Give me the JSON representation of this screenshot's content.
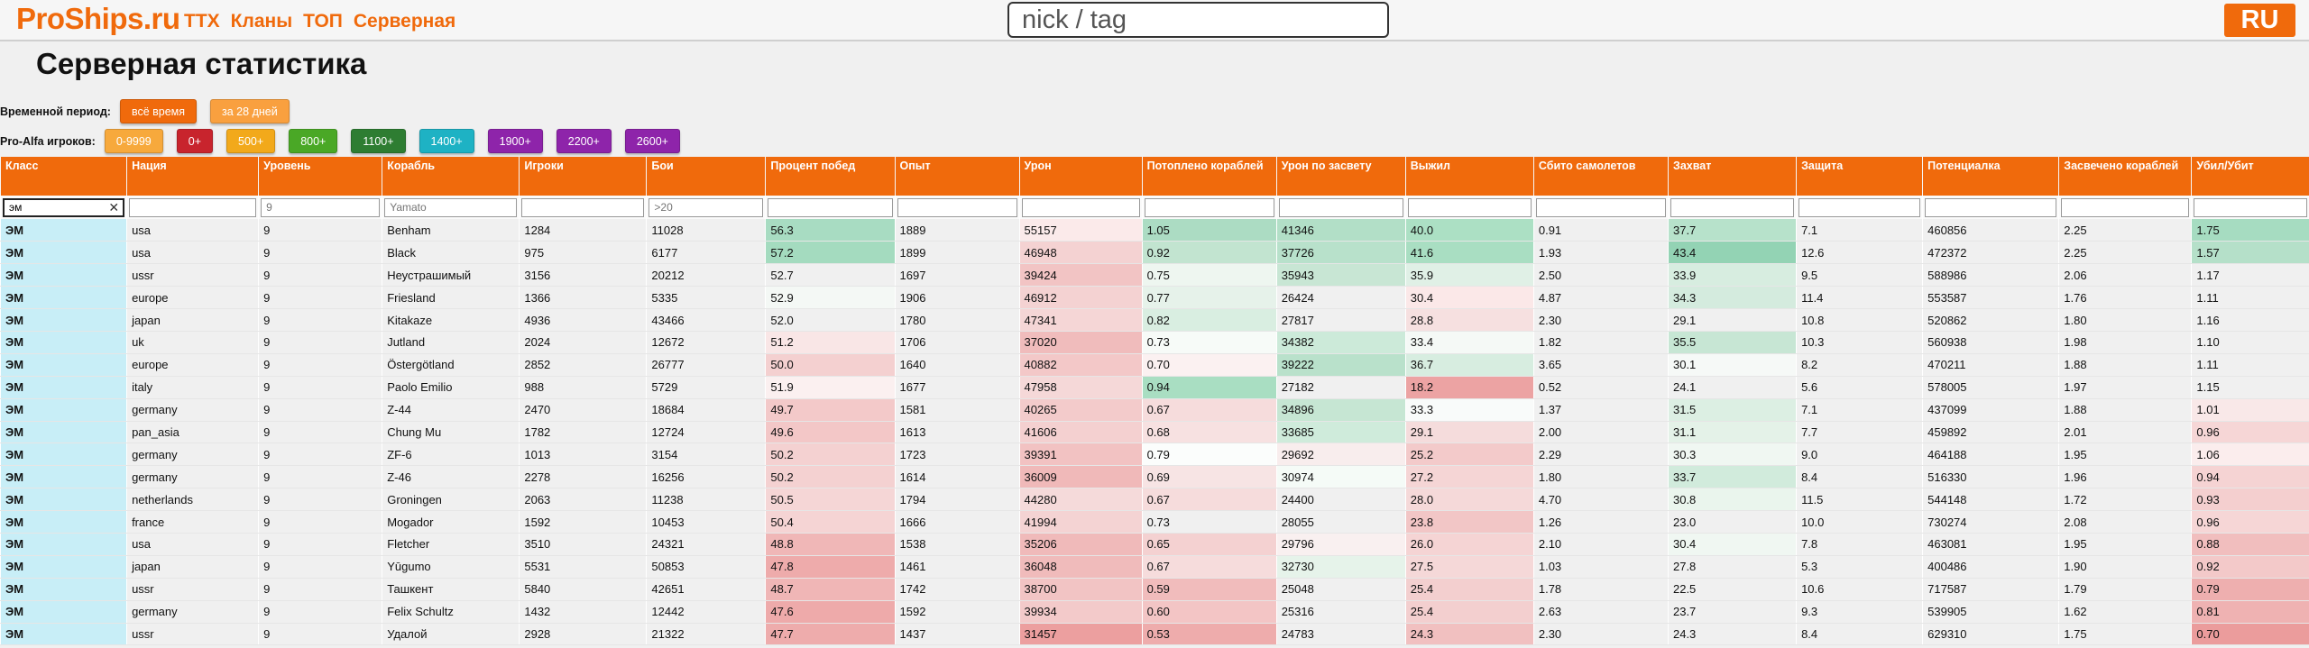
{
  "brand": {
    "logo": "ProShips.ru"
  },
  "nav": [
    "ТТХ",
    "Кланы",
    "ТОП",
    "Серверная"
  ],
  "search": {
    "placeholder": "nick / tag",
    "value": ""
  },
  "lang_button": "RU",
  "page_title": "Серверная статистика",
  "period": {
    "label": "Временной период:",
    "options": [
      {
        "label": "всё время",
        "color": "#f06a0c"
      },
      {
        "label": "за 28 дней",
        "color": "#f9a03f"
      }
    ]
  },
  "players": {
    "label": "Pro-Alfa игроков:",
    "options": [
      {
        "label": "0-9999",
        "color": "#f7a93c"
      },
      {
        "label": "0+",
        "color": "#c8242d"
      },
      {
        "label": "500+",
        "color": "#f2a91b"
      },
      {
        "label": "800+",
        "color": "#4aa826"
      },
      {
        "label": "1100+",
        "color": "#2e7d32"
      },
      {
        "label": "1400+",
        "color": "#1eb2c4"
      },
      {
        "label": "1900+",
        "color": "#8e24aa"
      },
      {
        "label": "2200+",
        "color": "#8e24aa"
      },
      {
        "label": "2600+",
        "color": "#8e24aa"
      }
    ]
  },
  "table": {
    "columns": [
      "Класс",
      "Нация",
      "Уровень",
      "Корабль",
      "Игроки",
      "Бои",
      "Процент побед",
      "Опыт",
      "Урон",
      "Потоплено кораблей",
      "Урон по засвету",
      "Выжил",
      "Сбито самолетов",
      "Захват",
      "Защита",
      "Потенциалка",
      "Засвечено кораблей",
      "Убил/Убит"
    ],
    "filters": [
      {
        "value": "эм",
        "placeholder": ""
      },
      {
        "value": "",
        "placeholder": ""
      },
      {
        "value": "",
        "placeholder": "9"
      },
      {
        "value": "",
        "placeholder": "Yamato"
      },
      {
        "value": "",
        "placeholder": ""
      },
      {
        "value": "",
        "placeholder": ">20"
      },
      {
        "value": "",
        "placeholder": ""
      },
      {
        "value": "",
        "placeholder": ""
      },
      {
        "value": "",
        "placeholder": ""
      },
      {
        "value": "",
        "placeholder": ""
      },
      {
        "value": "",
        "placeholder": ""
      },
      {
        "value": "",
        "placeholder": ""
      },
      {
        "value": "",
        "placeholder": ""
      },
      {
        "value": "",
        "placeholder": ""
      },
      {
        "value": "",
        "placeholder": ""
      },
      {
        "value": "",
        "placeholder": ""
      },
      {
        "value": "",
        "placeholder": ""
      },
      {
        "value": "",
        "placeholder": ""
      }
    ],
    "rows": [
      [
        "ЭМ",
        "usa",
        "9",
        "Benham",
        "1284",
        "11028",
        "56.3",
        "1889",
        "55157",
        "1.05",
        "41346",
        "40.0",
        "0.91",
        "37.7",
        "7.1",
        "460856",
        "2.25",
        "1.75"
      ],
      [
        "ЭМ",
        "usa",
        "9",
        "Black",
        "975",
        "6177",
        "57.2",
        "1899",
        "46948",
        "0.92",
        "37726",
        "41.6",
        "1.93",
        "43.4",
        "12.6",
        "472372",
        "2.25",
        "1.57"
      ],
      [
        "ЭМ",
        "ussr",
        "9",
        "Неустрашимый",
        "3156",
        "20212",
        "52.7",
        "1697",
        "39424",
        "0.75",
        "35943",
        "35.9",
        "2.50",
        "33.9",
        "9.5",
        "588986",
        "2.06",
        "1.17"
      ],
      [
        "ЭМ",
        "europe",
        "9",
        "Friesland",
        "1366",
        "5335",
        "52.9",
        "1906",
        "46912",
        "0.77",
        "26424",
        "30.4",
        "4.87",
        "34.3",
        "11.4",
        "553587",
        "1.76",
        "1.11"
      ],
      [
        "ЭМ",
        "japan",
        "9",
        "Kitakaze",
        "4936",
        "43466",
        "52.0",
        "1780",
        "47341",
        "0.82",
        "27817",
        "28.8",
        "2.30",
        "29.1",
        "10.8",
        "520862",
        "1.80",
        "1.16"
      ],
      [
        "ЭМ",
        "uk",
        "9",
        "Jutland",
        "2024",
        "12672",
        "51.2",
        "1706",
        "37020",
        "0.73",
        "34382",
        "33.4",
        "1.82",
        "35.5",
        "10.3",
        "560938",
        "1.98",
        "1.10"
      ],
      [
        "ЭМ",
        "europe",
        "9",
        "Östergötland",
        "2852",
        "26777",
        "50.0",
        "1640",
        "40882",
        "0.70",
        "39222",
        "36.7",
        "3.65",
        "30.1",
        "8.2",
        "470211",
        "1.88",
        "1.11"
      ],
      [
        "ЭМ",
        "italy",
        "9",
        "Paolo Emilio",
        "988",
        "5729",
        "51.9",
        "1677",
        "47958",
        "0.94",
        "27182",
        "18.2",
        "0.52",
        "24.1",
        "5.6",
        "578005",
        "1.97",
        "1.15"
      ],
      [
        "ЭМ",
        "germany",
        "9",
        "Z-44",
        "2470",
        "18684",
        "49.7",
        "1581",
        "40265",
        "0.67",
        "34896",
        "33.3",
        "1.37",
        "31.5",
        "7.1",
        "437099",
        "1.88",
        "1.01"
      ],
      [
        "ЭМ",
        "pan_asia",
        "9",
        "Chung Mu",
        "1782",
        "12724",
        "49.6",
        "1613",
        "41606",
        "0.68",
        "33685",
        "29.1",
        "2.00",
        "31.1",
        "7.7",
        "459892",
        "2.01",
        "0.96"
      ],
      [
        "ЭМ",
        "germany",
        "9",
        "ZF-6",
        "1013",
        "3154",
        "50.2",
        "1723",
        "39391",
        "0.79",
        "29692",
        "25.2",
        "2.29",
        "30.3",
        "9.0",
        "464188",
        "1.95",
        "1.06"
      ],
      [
        "ЭМ",
        "germany",
        "9",
        "Z-46",
        "2278",
        "16256",
        "50.2",
        "1614",
        "36009",
        "0.69",
        "30974",
        "27.2",
        "1.80",
        "33.7",
        "8.4",
        "516330",
        "1.96",
        "0.94"
      ],
      [
        "ЭМ",
        "netherlands",
        "9",
        "Groningen",
        "2063",
        "11238",
        "50.5",
        "1794",
        "44280",
        "0.67",
        "24400",
        "28.0",
        "4.70",
        "30.8",
        "11.5",
        "544148",
        "1.72",
        "0.93"
      ],
      [
        "ЭМ",
        "france",
        "9",
        "Mogador",
        "1592",
        "10453",
        "50.4",
        "1666",
        "41994",
        "0.73",
        "28055",
        "23.8",
        "1.26",
        "23.0",
        "10.0",
        "730274",
        "2.08",
        "0.96"
      ],
      [
        "ЭМ",
        "usa",
        "9",
        "Fletcher",
        "3510",
        "24321",
        "48.8",
        "1538",
        "35206",
        "0.65",
        "29796",
        "26.0",
        "2.10",
        "30.4",
        "7.8",
        "463081",
        "1.95",
        "0.88"
      ],
      [
        "ЭМ",
        "japan",
        "9",
        "Yūgumo",
        "5531",
        "50853",
        "47.8",
        "1461",
        "36048",
        "0.67",
        "32730",
        "27.5",
        "1.03",
        "27.8",
        "5.3",
        "400486",
        "1.90",
        "0.92"
      ],
      [
        "ЭМ",
        "ussr",
        "9",
        "Ташкент",
        "5840",
        "42651",
        "48.7",
        "1742",
        "38700",
        "0.59",
        "25048",
        "25.4",
        "1.78",
        "22.5",
        "10.6",
        "717587",
        "1.79",
        "0.79"
      ],
      [
        "ЭМ",
        "germany",
        "9",
        "Felix Schultz",
        "1432",
        "12442",
        "47.6",
        "1592",
        "39934",
        "0.60",
        "25316",
        "25.4",
        "2.63",
        "23.7",
        "9.3",
        "539905",
        "1.62",
        "0.81"
      ],
      [
        "ЭМ",
        "ussr",
        "9",
        "Удалой",
        "2928",
        "21322",
        "47.7",
        "1437",
        "31457",
        "0.53",
        "24783",
        "24.3",
        "2.30",
        "24.3",
        "8.4",
        "629310",
        "1.75",
        "0.70"
      ]
    ],
    "cell_colors": [
      [
        "",
        "",
        "",
        "",
        "",
        "",
        "#a8dcc2",
        "",
        "#fbeaea",
        "#acdcc3",
        "#b2dfc7",
        "#ace0c4",
        "",
        "#b7e2cb",
        "",
        "",
        "",
        "#a6dcc1"
      ],
      [
        "",
        "",
        "",
        "",
        "",
        "",
        "#a4dbbf",
        "",
        "#f4d2d2",
        "#c2e4d0",
        "#b8e1cb",
        "#a9deC2",
        "",
        "#93d3b4",
        "",
        "",
        "",
        "#b5e0c9"
      ],
      [
        "",
        "",
        "",
        "",
        "",
        "",
        "",
        "",
        "#f2c4c4",
        "#eef6f0",
        "#c8e6d4",
        "#e0f0e6",
        "",
        "#d7ede0",
        "",
        "",
        "",
        ""
      ],
      [
        "",
        "",
        "",
        "",
        "",
        "",
        "#f4f8f5",
        "",
        "#f4d2d2",
        "#e6f2ea",
        "",
        "#fbe8e8",
        "",
        "#d4ebde",
        "",
        "",
        "",
        ""
      ],
      [
        "",
        "",
        "",
        "",
        "",
        "",
        "",
        "",
        "#f5d6d6",
        "#d9eee1",
        "",
        "#f6e0e0",
        "",
        "",
        "",
        "",
        "",
        ""
      ],
      [
        "",
        "",
        "",
        "",
        "",
        "",
        "#f9e6e6",
        "",
        "#f0bcbc",
        "#f7fbf8",
        "#ccead9",
        "#f5f9f6",
        "",
        "#c7e6d4",
        "",
        "",
        "",
        ""
      ],
      [
        "",
        "",
        "",
        "",
        "",
        "",
        "#f4d0d0",
        "",
        "#f3c8c8",
        "#fbf1f1",
        "#b9e1cb",
        "#d7ede0",
        "",
        "#f6f9f7",
        "",
        "",
        "",
        ""
      ],
      [
        "",
        "",
        "",
        "",
        "",
        "",
        "#fbf0f0",
        "",
        "#f5d8d8",
        "#a9dec2",
        "",
        "#eca3a3",
        "",
        "",
        "",
        "",
        "",
        ""
      ],
      [
        "",
        "",
        "",
        "",
        "",
        "",
        "#f3c9c9",
        "",
        "#f3cbcb",
        "#f6dcdc",
        "#c6e6d3",
        "#f9fbfa",
        "",
        "#dcefe3",
        "",
        "",
        "",
        "#f9e8e8"
      ],
      [
        "",
        "",
        "",
        "",
        "",
        "",
        "#f3c7c7",
        "",
        "#f4d0d0",
        "#f7e1e1",
        "#cfebdb",
        "#f5dcdc",
        "",
        "#e4f2e8",
        "",
        "",
        "",
        "#f6d6d6"
      ],
      [
        "",
        "",
        "",
        "",
        "",
        "",
        "#f4d1d1",
        "",
        "#f2c2c2",
        "#fbfdfc",
        "#f8eded",
        "#f3caca",
        "",
        "#f0f7f2",
        "",
        "",
        "",
        "#fbeded"
      ],
      [
        "",
        "",
        "",
        "",
        "",
        "",
        "#f4d1d1",
        "",
        "#f0b9b9",
        "#f7e4e4",
        "#f5fbf7",
        "#f5d5d5",
        "",
        "#d1ebdc",
        "",
        "",
        "",
        "#f5d3d3"
      ],
      [
        "",
        "",
        "",
        "",
        "",
        "",
        "#f5d6d6",
        "",
        "#f5dada",
        "#f6dcdc",
        "",
        "#f5d9d9",
        "",
        "#eaf5ed",
        "",
        "",
        "",
        "#f4cfcf"
      ],
      [
        "",
        "",
        "",
        "",
        "",
        "",
        "#f5d4d4",
        "",
        "#f4d3d3",
        "",
        "",
        "#f2c6c6",
        "",
        "",
        "",
        "",
        "",
        "#f6d6d6"
      ],
      [
        "",
        "",
        "",
        "",
        "",
        "",
        "#f0b7b7",
        "",
        "#f0baba",
        "#f4d1d1",
        "#f9f0f0",
        "#f5d4d4",
        "",
        "#f0f7f2",
        "",
        "",
        "",
        "#f1bebe"
      ],
      [
        "",
        "",
        "",
        "",
        "",
        "",
        "#eeabab",
        "",
        "#f0bbbb",
        "#f6dcdc",
        "#e6f3ea",
        "#f5d8d8",
        "",
        "",
        "",
        "",
        "",
        "#f3c9c9"
      ],
      [
        "",
        "",
        "",
        "",
        "",
        "",
        "#f0b6b6",
        "",
        "#f2c4c4",
        "#f1bcbc",
        "",
        "#f3cfcf",
        "",
        "",
        "",
        "",
        "",
        "#eeafaf"
      ],
      [
        "",
        "",
        "",
        "",
        "",
        "",
        "#eeaaaa",
        "",
        "#f3caca",
        "#f3c5c5",
        "",
        "#f3cfcf",
        "",
        "",
        "",
        "",
        "",
        "#efb2b2"
      ],
      [
        "",
        "",
        "",
        "",
        "",
        "",
        "#eeacac",
        "",
        "#ec9f9f",
        "#eeacac",
        "",
        "#f1c0c0",
        "",
        "",
        "",
        "",
        "",
        "#eb9c9c"
      ]
    ]
  }
}
